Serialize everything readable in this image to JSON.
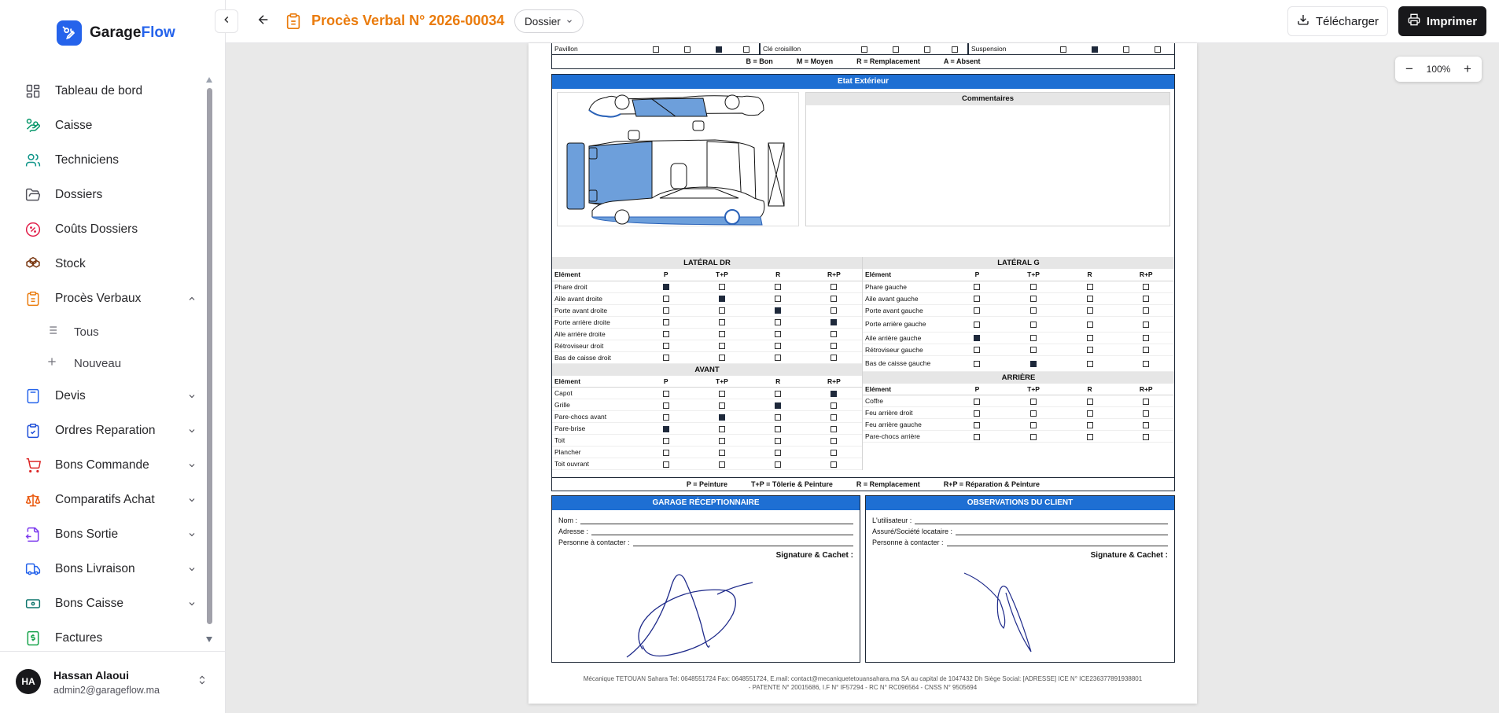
{
  "brand": {
    "name_main": "Garage",
    "name_accent": "Flow"
  },
  "sidebar": {
    "items": [
      {
        "label": "Tableau de bord",
        "icon": "grid-icon"
      },
      {
        "label": "Caisse",
        "icon": "hand-coins-icon"
      },
      {
        "label": "Techniciens",
        "icon": "users-icon"
      },
      {
        "label": "Dossiers",
        "icon": "folder-icon"
      },
      {
        "label": "Coûts Dossiers",
        "icon": "percent-icon"
      },
      {
        "label": "Stock",
        "icon": "boxes-icon"
      },
      {
        "label": "Procès Verbaux",
        "icon": "clipboard-icon"
      },
      {
        "label": "Devis",
        "icon": "calculator-icon"
      },
      {
        "label": "Ordres Reparation",
        "icon": "clipboard-check-icon"
      },
      {
        "label": "Bons Commande",
        "icon": "cart-icon"
      },
      {
        "label": "Comparatifs Achat",
        "icon": "scale-icon"
      },
      {
        "label": "Bons Sortie",
        "icon": "file-out-icon"
      },
      {
        "label": "Bons Livraison",
        "icon": "truck-icon"
      },
      {
        "label": "Bons Caisse",
        "icon": "banknote-icon"
      },
      {
        "label": "Factures",
        "icon": "invoice-icon"
      }
    ],
    "sub_items": [
      {
        "label": "Tous"
      },
      {
        "label": "Nouveau"
      }
    ]
  },
  "user": {
    "initials": "HA",
    "name": "Hassan Alaoui",
    "email": "admin2@garageflow.ma"
  },
  "header": {
    "title": "Procès Verbal N° 2026-00034",
    "dossier_label": "Dossier",
    "download_label": "Télécharger",
    "print_label": "Imprimer"
  },
  "zoom": {
    "value": "100%"
  },
  "colors": {
    "accent": "#2563eb",
    "title": "#ea7b0c",
    "pv_blue": "#1e6fd3"
  },
  "pv": {
    "top_rows": [
      {
        "element": "Pavillon",
        "checks": [
          0,
          0,
          1,
          0
        ]
      },
      {
        "element": "Clé croisillon",
        "checks": [
          0,
          0,
          0,
          0
        ]
      },
      {
        "element": "Suspension",
        "checks": [
          0,
          1,
          0,
          0
        ]
      }
    ],
    "legend1": [
      "B = Bon",
      "M = Moyen",
      "R = Remplacement",
      "A = Absent"
    ],
    "exterior_title": "Etat Extérieur",
    "comments_title": "Commentaires",
    "col_headers": [
      "Elément",
      "P",
      "T+P",
      "R",
      "R+P"
    ],
    "lateral_dr": {
      "title": "LATÉRAL DR",
      "rows": [
        {
          "name": "Phare droit",
          "checks": [
            1,
            0,
            0,
            0
          ]
        },
        {
          "name": "Aile avant droite",
          "checks": [
            0,
            1,
            0,
            0
          ]
        },
        {
          "name": "Porte avant droite",
          "checks": [
            0,
            0,
            1,
            0
          ]
        },
        {
          "name": "Porte arrière droite",
          "checks": [
            0,
            0,
            0,
            1
          ]
        },
        {
          "name": "Aile arrière droite",
          "checks": [
            0,
            0,
            0,
            0
          ]
        },
        {
          "name": "Rétroviseur droit",
          "checks": [
            0,
            0,
            0,
            0
          ]
        },
        {
          "name": "Bas de caisse droit",
          "checks": [
            0,
            0,
            0,
            0
          ]
        }
      ]
    },
    "lateral_g": {
      "title": "LATÉRAL G",
      "rows": [
        {
          "name": "Phare gauche",
          "checks": [
            0,
            0,
            0,
            0
          ]
        },
        {
          "name": "Aile avant gauche",
          "checks": [
            0,
            0,
            0,
            0
          ]
        },
        {
          "name": "Porte avant gauche",
          "checks": [
            0,
            0,
            0,
            0
          ]
        },
        {
          "name": "Porte arrière gauche",
          "checks": [
            0,
            0,
            0,
            0
          ]
        },
        {
          "name": "Aile arrière gauche",
          "checks": [
            1,
            0,
            0,
            0
          ]
        },
        {
          "name": "Rétroviseur gauche",
          "checks": [
            0,
            0,
            0,
            0
          ]
        },
        {
          "name": "Bas de caisse gauche",
          "checks": [
            0,
            1,
            0,
            0
          ]
        }
      ]
    },
    "avant": {
      "title": "AVANT",
      "rows": [
        {
          "name": "Capot",
          "checks": [
            0,
            0,
            0,
            1
          ]
        },
        {
          "name": "Grille",
          "checks": [
            0,
            0,
            1,
            0
          ]
        },
        {
          "name": "Pare-chocs avant",
          "checks": [
            0,
            1,
            0,
            0
          ]
        },
        {
          "name": "Pare-brise",
          "checks": [
            1,
            0,
            0,
            0
          ]
        },
        {
          "name": "Toit",
          "checks": [
            0,
            0,
            0,
            0
          ]
        },
        {
          "name": "Plancher",
          "checks": [
            0,
            0,
            0,
            0
          ]
        },
        {
          "name": "Toit ouvrant",
          "checks": [
            0,
            0,
            0,
            0
          ]
        }
      ]
    },
    "arriere": {
      "title": "ARRIÈRE",
      "rows": [
        {
          "name": "Coffre",
          "checks": [
            0,
            0,
            0,
            0
          ]
        },
        {
          "name": "Feu arrière droit",
          "checks": [
            0,
            0,
            0,
            0
          ]
        },
        {
          "name": "Feu arrière gauche",
          "checks": [
            0,
            0,
            0,
            0
          ]
        },
        {
          "name": "Pare-chocs arrière",
          "checks": [
            0,
            0,
            0,
            0
          ]
        }
      ]
    },
    "legend2": [
      "P = Peinture",
      "T+P = Tôlerie & Peinture",
      "R = Remplacement",
      "R+P = Réparation & Peinture"
    ],
    "garage": {
      "title": "GARAGE RÉCEPTIONNAIRE",
      "fields": [
        "Nom :",
        "Adresse :",
        "Personne à contacter :"
      ],
      "signature": "Signature & Cachet :"
    },
    "client": {
      "title": "OBSERVATIONS DU CLIENT",
      "fields": [
        "L'utilisateur :",
        "Assuré/Société locataire :",
        "Personne à contacter :"
      ],
      "signature": "Signature & Cachet :"
    },
    "footer_line1": "Mécanique TETOUAN Sahara Tel: 0648551724 Fax: 0648551724, E.mail: contact@mecaniquetetouansahara.ma SA au capital de 1047432 Dh Siège Social: [ADRESSE] ICE N° ICE236377891938801",
    "footer_line2": "- PATENTE N° 20015686, I.F N° IF57294 - RC N° RC096564 - CNSS N° 9505694"
  }
}
